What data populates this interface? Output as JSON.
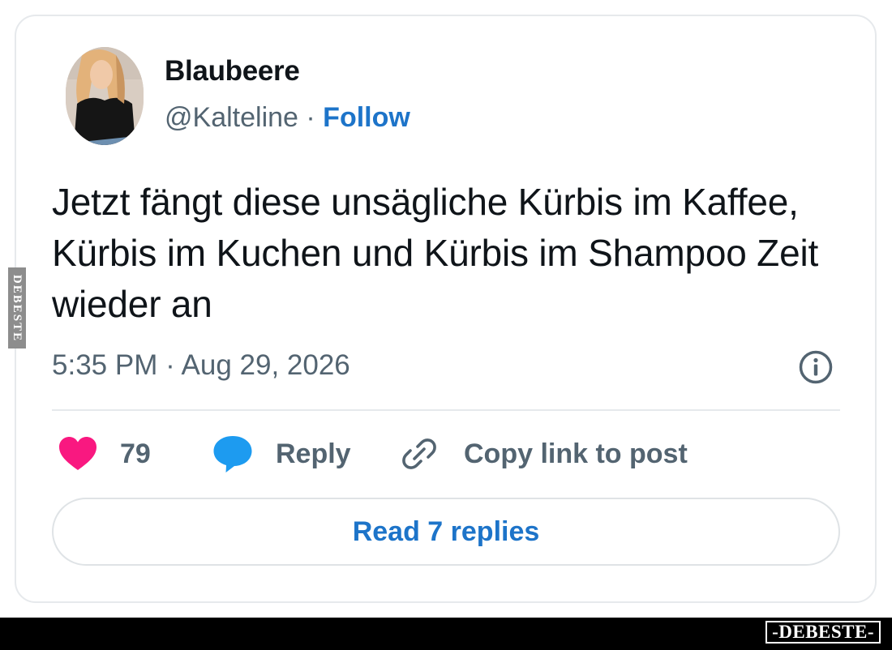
{
  "author": {
    "display_name": "Blaubeere",
    "handle": "@Kalteline",
    "separator": "·",
    "follow_label": "Follow"
  },
  "post": {
    "text": "Jetzt fängt diese unsägliche Kürbis im Kaffee, Kürbis im Kuchen und Kürbis im Shampoo Zeit wieder an",
    "timestamp": "5:35 PM · Aug 29, 2026"
  },
  "actions": {
    "like_count": "79",
    "reply_label": "Reply",
    "copy_link_label": "Copy link to post"
  },
  "read_replies_label": "Read 7 replies",
  "watermarks": {
    "side": "DEBESTE",
    "footer": "-DEBESTE-"
  },
  "icons": {
    "like": "heart-icon",
    "reply": "speech-bubble-icon",
    "copy_link": "link-icon",
    "info": "info-icon"
  },
  "colors": {
    "heart": "#f91880",
    "reply_bubble": "#1d9bf0",
    "link_blue": "#1d74c9",
    "muted_text": "#536471",
    "border": "#e6e9ec"
  }
}
